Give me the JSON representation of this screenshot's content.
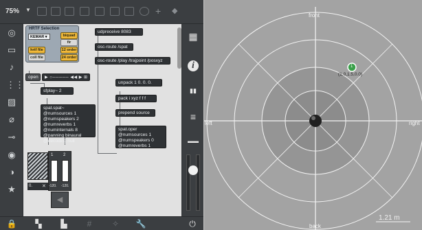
{
  "toolbar": {
    "zoom": "75%",
    "icons": [
      "presentation-icon",
      "mixer-icon",
      "object-box-icon",
      "grid-icon",
      "lock-toggle-icon",
      "sidebar-icon",
      "inspector-icon",
      "clock-icon",
      "add-icon",
      "paint-icon"
    ]
  },
  "left_sidebar": {
    "icons": [
      {
        "name": "target-icon",
        "glyph": "◎"
      },
      {
        "name": "window-icon",
        "glyph": "▭"
      },
      {
        "name": "music-note-icon",
        "glyph": "♪"
      },
      {
        "name": "console-icon",
        "glyph": "⋮⋮"
      },
      {
        "name": "image-icon",
        "glyph": "▨"
      },
      {
        "name": "paperclip-icon",
        "glyph": "⌀"
      },
      {
        "name": "plug-icon",
        "glyph": "⊸"
      },
      {
        "name": "color-icon",
        "glyph": "◉"
      },
      {
        "name": "beat-icon",
        "glyph": "◑"
      },
      {
        "name": "star-icon",
        "glyph": "★"
      }
    ]
  },
  "hrtf_panel": {
    "title": "HRTF Selection",
    "dataset_select": "KEMAR ▾",
    "biquad": "biquad",
    "fir": "fir",
    "hrtf_file": "hrtf file",
    "order12": "12 order",
    "coll_file": "coll file",
    "order24": "24 order"
  },
  "objects": {
    "open": "open",
    "playbar_glyphs": "▶ ○───── ◀◀ ▶ ⊞",
    "sfplay": "sfplay~ 2",
    "udpreceive": "udpreceive 8083",
    "osc_spat": "osc-route /spat",
    "osc_play": "osc-route /play /trajpoint /posxyz",
    "unpack": "unpack 1 0. 0. 0.",
    "pack": "pack i xyz f f f",
    "prepend": "prepend source",
    "spat_lines": [
      "spat.spat~",
      "@numsources 1",
      "@numspeakers 2",
      "@numreverbs 1",
      "@numinternals 8",
      "@panning binaural",
      "@decoding null"
    ],
    "oper_lines": [
      "spat.oper",
      "@numsources 1",
      "@numspeakers 0",
      "@numreverbs 1"
    ],
    "gain_left": "0.",
    "close_x": "✕",
    "ch1": "1",
    "ch2": "2",
    "db1": "-120.",
    "db2": "-120."
  },
  "right_sidebar": {
    "icons": [
      {
        "name": "grid-view-icon",
        "glyph": "▦"
      },
      {
        "name": "info-icon",
        "glyph": "i"
      },
      {
        "name": "book-icon",
        "glyph": "▮▮"
      },
      {
        "name": "list-icon",
        "glyph": "≡"
      },
      {
        "name": "panel-icon",
        "glyph": "▬▬"
      }
    ]
  },
  "bottom_bar": {
    "icons": [
      {
        "name": "lock-icon",
        "glyph": "🔒"
      },
      {
        "name": "layers-icon",
        "glyph": "▚"
      },
      {
        "name": "presentation-screen-icon",
        "glyph": "▙"
      },
      {
        "name": "grid-icon",
        "glyph": "#"
      },
      {
        "name": "magic-icon",
        "glyph": "✧"
      },
      {
        "name": "wrench-icon",
        "glyph": "🔧"
      },
      {
        "name": "power-icon",
        "glyph": "⏻"
      }
    ]
  },
  "viewer": {
    "front": "front",
    "back": "back",
    "left": "left",
    "right": "right",
    "source_id": "1",
    "source_coords": "(1.0,1.5,0.0)",
    "scale": "1.21 m",
    "colors": {
      "bg": "#a3a3a3",
      "rings": "#f4f4f4",
      "inner_fill": "#8e8e8e",
      "source": "#3aa04a"
    }
  }
}
